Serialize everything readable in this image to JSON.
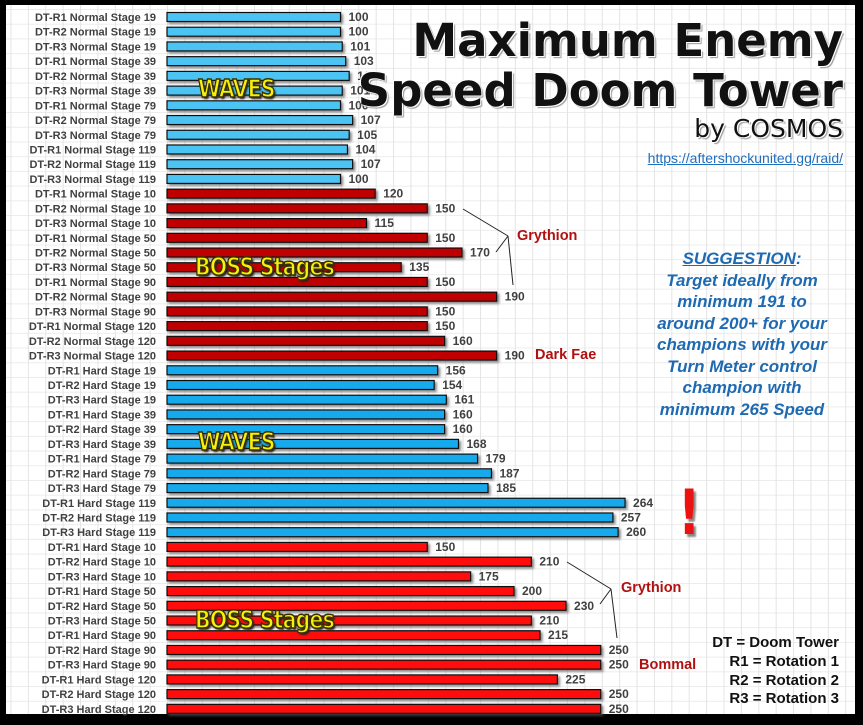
{
  "chart_data": {
    "type": "bar",
    "orientation": "horizontal",
    "title": "Maximum Enemy Speed Doom Tower",
    "subtitle": "by COSMOS",
    "source_url": "https://aftershockunited.gg/raid/",
    "xlabel": "",
    "ylabel": "",
    "xlim": [
      0,
      264
    ],
    "grid": true,
    "categories": [
      "DT-R1 Normal Stage 19",
      "DT-R2 Normal Stage 19",
      "DT-R3 Normal Stage 19",
      "DT-R1 Normal Stage 39",
      "DT-R2 Normal Stage 39",
      "DT-R3 Normal Stage 39",
      "DT-R1 Normal Stage 79",
      "DT-R2 Normal Stage 79",
      "DT-R3 Normal Stage 79",
      "DT-R1 Normal Stage 119",
      "DT-R2 Normal Stage 119",
      "DT-R3 Normal Stage 119",
      "DT-R1 Normal Stage 10",
      "DT-R2 Normal Stage 10",
      "DT-R3 Normal Stage 10",
      "DT-R1 Normal Stage 50",
      "DT-R2 Normal Stage 50",
      "DT-R3 Normal Stage 50",
      "DT-R1 Normal Stage 90",
      "DT-R2 Normal Stage 90",
      "DT-R3 Normal Stage 90",
      "DT-R1 Normal Stage 120",
      "DT-R2 Normal Stage 120",
      "DT-R3 Normal Stage 120",
      "DT-R1 Hard Stage 19",
      "DT-R2 Hard Stage 19",
      "DT-R3 Hard Stage 19",
      "DT-R1 Hard Stage 39",
      "DT-R2 Hard Stage 39",
      "DT-R3 Hard Stage 39",
      "DT-R1 Hard Stage 79",
      "DT-R2 Hard Stage 79",
      "DT-R3 Hard Stage 79",
      "DT-R1 Hard Stage 119",
      "DT-R2 Hard Stage 119",
      "DT-R3 Hard Stage 119",
      "DT-R1 Hard Stage 10",
      "DT-R2 Hard Stage 10",
      "DT-R3 Hard Stage 10",
      "DT-R1 Hard Stage 50",
      "DT-R2 Hard Stage 50",
      "DT-R3 Hard Stage 50",
      "DT-R1 Hard Stage 90",
      "DT-R2 Hard Stage 90",
      "DT-R3 Hard Stage 90",
      "DT-R1 Hard Stage 120",
      "DT-R2 Hard Stage 120",
      "DT-R3 Hard Stage 120"
    ],
    "values": [
      100,
      100,
      101,
      103,
      105,
      101,
      100,
      107,
      105,
      104,
      107,
      100,
      120,
      150,
      115,
      150,
      170,
      135,
      150,
      190,
      150,
      150,
      160,
      190,
      156,
      154,
      161,
      160,
      160,
      168,
      179,
      187,
      185,
      264,
      257,
      260,
      150,
      210,
      175,
      200,
      230,
      210,
      215,
      250,
      250,
      225,
      250,
      250
    ],
    "groups": [
      {
        "name": "Normal Waves",
        "start": 0,
        "count": 12,
        "color": "#4cc4f4",
        "overlay": "WAVES"
      },
      {
        "name": "Normal Boss Stages",
        "start": 12,
        "count": 12,
        "color": "#c00000",
        "overlay": "BOSS Stages"
      },
      {
        "name": "Hard Waves",
        "start": 24,
        "count": 12,
        "color": "#14aaec",
        "overlay": "WAVES"
      },
      {
        "name": "Hard Boss Stages",
        "start": 36,
        "count": 12,
        "color": "#ff0d0d",
        "overlay": "BOSS Stages"
      }
    ],
    "annotations": [
      {
        "text": "Grythion",
        "points_to": [
          "DT-R2 Normal Stage 10",
          "DT-R2 Normal Stage 50",
          "DT-R2 Normal Stage 90"
        ]
      },
      {
        "text": "Dark Fae",
        "points_to": [
          "DT-R3 Normal Stage 120"
        ]
      },
      {
        "text": "Grythion",
        "points_to": [
          "DT-R2 Hard Stage 10",
          "DT-R2 Hard Stage 50",
          "DT-R2 Hard Stage 90"
        ]
      },
      {
        "text": "Bommal",
        "points_to": [
          "DT-R3 Hard Stage 90"
        ]
      },
      {
        "text": "!",
        "points_to": [
          "DT-R1 Hard Stage 119",
          "DT-R2 Hard Stage 119",
          "DT-R3 Hard Stage 119"
        ]
      }
    ]
  },
  "header": {
    "title_line1": "Maximum Enemy",
    "title_line2": "Speed Doom Tower",
    "byline": "by COSMOS",
    "url": "https://aftershockunited.gg/raid/"
  },
  "suggestion": {
    "heading": "SUGGESTION",
    "lines": [
      "Target ideally from",
      "minimum 191 to",
      "around 200+ for your",
      "champions with your",
      "Turn Meter control",
      "champion with",
      "minimum 265 Speed"
    ]
  },
  "overlays": {
    "waves": "WAVES",
    "boss": "BOSS Stages",
    "exclaim": "!"
  },
  "annotation_labels": {
    "grythion_normal": "Grythion",
    "dark_fae": "Dark Fae",
    "grythion_hard": "Grythion",
    "bommal": "Bommal"
  },
  "legend": {
    "lines": [
      "DT = Doom Tower",
      "R1 = Rotation 1",
      "R2 = Rotation 2",
      "R3 = Rotation 3"
    ]
  }
}
